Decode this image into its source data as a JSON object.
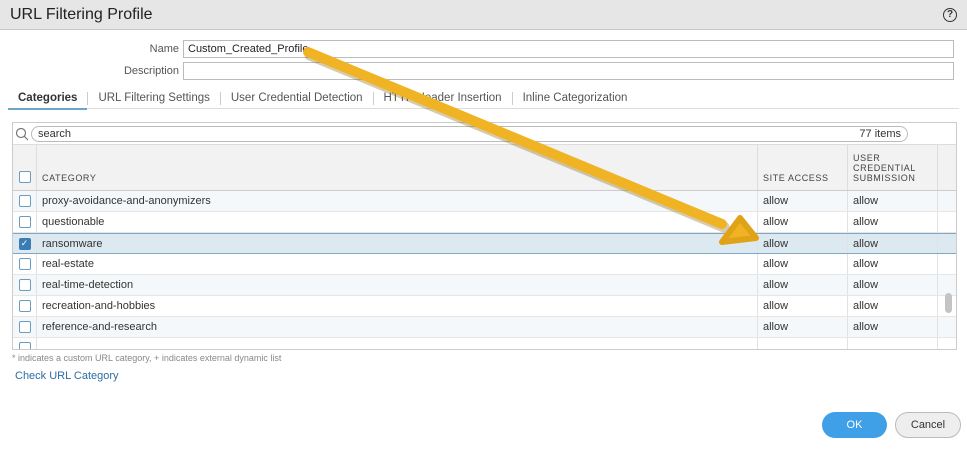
{
  "window": {
    "title": "URL Filtering Profile",
    "help_icon": "help-icon"
  },
  "form": {
    "name_label": "Name",
    "name_value": "Custom_Created_Profile",
    "description_label": "Description",
    "description_value": ""
  },
  "tabs": [
    {
      "label": "Categories",
      "active": true
    },
    {
      "label": "URL Filtering Settings"
    },
    {
      "label": "User Credential Detection"
    },
    {
      "label": "HTTP Header Insertion"
    },
    {
      "label": "Inline Categorization"
    }
  ],
  "search": {
    "placeholder": "search",
    "count": "77 items"
  },
  "columns": {
    "category": "CATEGORY",
    "site_access": "SITE ACCESS",
    "user_cred": "USER CREDENTIAL SUBMISSION"
  },
  "rows": [
    {
      "category": "proxy-avoidance-and-anonymizers",
      "site": "allow",
      "cred": "allow",
      "checked": false
    },
    {
      "category": "questionable",
      "site": "allow",
      "cred": "allow",
      "checked": false
    },
    {
      "category": "ransomware",
      "site": "allow",
      "cred": "allow",
      "checked": true
    },
    {
      "category": "real-estate",
      "site": "allow",
      "cred": "allow",
      "checked": false
    },
    {
      "category": "real-time-detection",
      "site": "allow",
      "cred": "allow",
      "checked": false
    },
    {
      "category": "recreation-and-hobbies",
      "site": "allow",
      "cred": "allow",
      "checked": false
    },
    {
      "category": "reference-and-research",
      "site": "allow",
      "cred": "allow",
      "checked": false
    }
  ],
  "footer": {
    "note": "* indicates a custom URL category, + indicates external dynamic list",
    "check_link": "Check URL Category"
  },
  "buttons": {
    "ok": "OK",
    "cancel": "Cancel"
  },
  "colors": {
    "accent": "#3fa0e8",
    "arrow": "#f0b323"
  }
}
